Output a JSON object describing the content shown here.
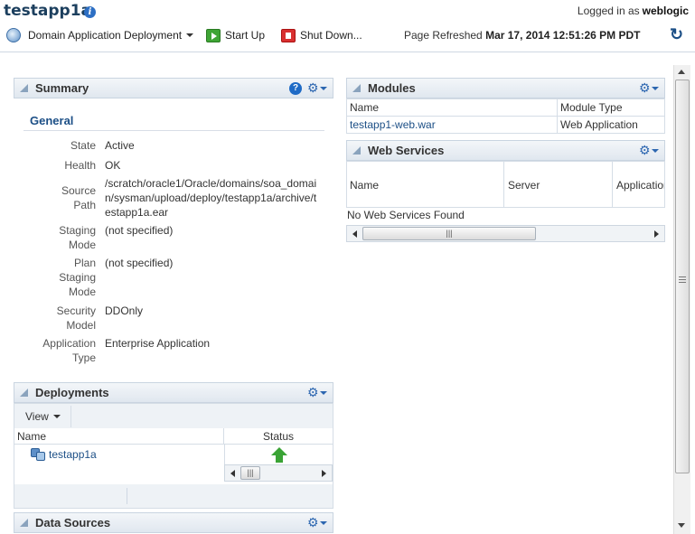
{
  "header": {
    "title": "testapp1a",
    "logged_in_label": "Logged in as",
    "username": "weblogic"
  },
  "toolbar": {
    "menu_label": "Domain Application Deployment",
    "start_label": "Start Up",
    "shutdown_label": "Shut Down...",
    "refreshed_label": "Page Refreshed",
    "refreshed_time": "Mar 17, 2014 12:51:26 PM PDT"
  },
  "summary": {
    "title": "Summary",
    "section": "General",
    "rows": [
      {
        "label": "State",
        "value": "Active"
      },
      {
        "label": "Health",
        "value": "OK"
      },
      {
        "label": "Source Path",
        "value": "/scratch/oracle1/Oracle/domains/soa_domain/sysman/upload/deploy/testapp1a/archive/testapp1a.ear"
      },
      {
        "label": "Staging Mode",
        "value": "(not specified)"
      },
      {
        "label": "Plan Staging Mode",
        "value": "(not specified)"
      },
      {
        "label": "Security Model",
        "value": "DDOnly"
      },
      {
        "label": "Application Type",
        "value": "Enterprise Application"
      }
    ]
  },
  "deployments": {
    "title": "Deployments",
    "view_label": "View",
    "col_name": "Name",
    "col_status": "Status",
    "row_name": "testapp1a"
  },
  "data_sources": {
    "title": "Data Sources"
  },
  "modules": {
    "title": "Modules",
    "col_name": "Name",
    "col_type": "Module Type",
    "row_name": "testapp1-web.war",
    "row_type": "Web Application"
  },
  "web_services": {
    "title": "Web Services",
    "col_name": "Name",
    "col_server": "Server",
    "col_application": "Application",
    "empty_text": "No Web Services Found"
  },
  "colors": {
    "title": "#1c3f5e",
    "link": "#1c4f86",
    "header_bg": "#e0e7ef",
    "status_ok": "#3aa335"
  }
}
